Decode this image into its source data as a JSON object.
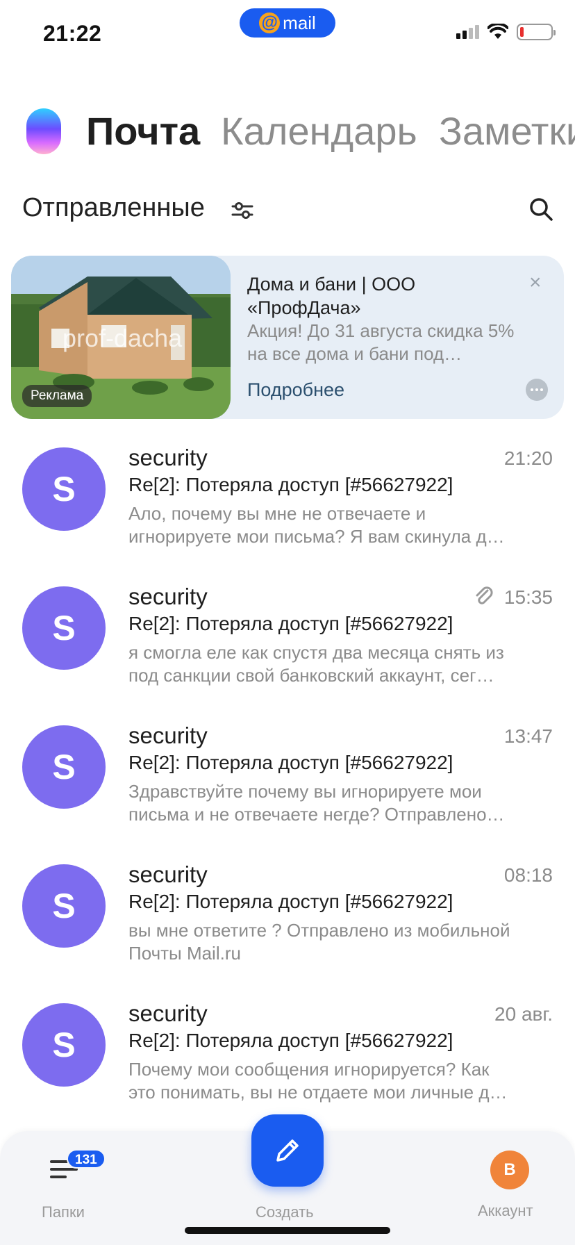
{
  "status_bar": {
    "time": "21:22",
    "pill_text": "mail",
    "pill_icon": "@",
    "battery_color": "#e8302f"
  },
  "app_tabs": {
    "items": [
      "Почта",
      "Календарь",
      "Заметки"
    ],
    "active_index": 0
  },
  "folder": {
    "title": "Отправленные"
  },
  "ad": {
    "title": "Дома и бани | ООО «ПрофДача»",
    "text": "Акция!  До 31 августа скидка 5% на все дома и бани под…",
    "link": "Подробнее",
    "badge": "Реклама",
    "watermark": "prof-dacha",
    "close": "×"
  },
  "messages": [
    {
      "avatar": "S",
      "sender": "security",
      "time": "21:20",
      "subject": "Re[2]: Потеряла доступ [#56627922]",
      "preview1": "Ало, почему вы мне не отвечаете и",
      "preview2": "игнорируете мои письма? Я вам скинула д…",
      "attachment": false
    },
    {
      "avatar": "S",
      "sender": "security",
      "time": "15:35",
      "subject": "Re[2]: Потеряла доступ [#56627922]",
      "preview1": "я смогла еле как спустя два месяца снять из",
      "preview2": "под санкции свой банковский аккаунт, сег…",
      "attachment": true
    },
    {
      "avatar": "S",
      "sender": "security",
      "time": "13:47",
      "subject": "Re[2]: Потеряла доступ [#56627922]",
      "preview1": "Здравствуйте почему вы игнорируете мои",
      "preview2": "письма и не отвечаете негде? Отправлено…",
      "attachment": false
    },
    {
      "avatar": "S",
      "sender": "security",
      "time": "08:18",
      "subject": "Re[2]: Потеряла доступ [#56627922]",
      "preview1": "вы мне ответите ? Отправлено из мобильной",
      "preview2": "Почты Mail.ru",
      "attachment": false
    },
    {
      "avatar": "S",
      "sender": "security",
      "time": "20 авг.",
      "subject": "Re[2]: Потеряла доступ [#56627922]",
      "preview1": "Почему мои сообщения игнорируется? Как",
      "preview2": "это понимать, вы не отдаете мои личные д…",
      "attachment": false
    }
  ],
  "bottom_bar": {
    "folders_label": "Папки",
    "folders_badge": "131",
    "compose_label": "Создать",
    "account_label": "Аккаунт",
    "account_initial": "В"
  },
  "colors": {
    "accent": "#1a5cf0",
    "avatar": "#7d6cef",
    "account_avatar": "#f0843a",
    "ad_background": "#e7eef6"
  }
}
